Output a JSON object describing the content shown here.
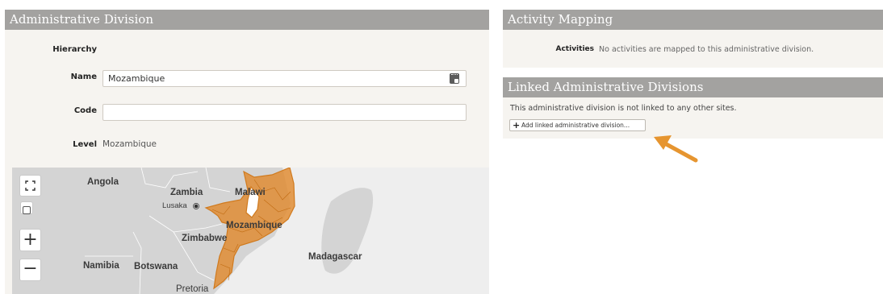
{
  "admin_division": {
    "header": "Administrative Division",
    "hierarchy_label": "Hierarchy",
    "name_label": "Name",
    "name_value": "Mozambique",
    "code_label": "Code",
    "code_value": "",
    "level_label": "Level",
    "level_value": "Mozambique"
  },
  "map": {
    "labels": {
      "angola": "Angola",
      "zambia": "Zambia",
      "malawi": "Malawi",
      "lusaka": "Lusaka",
      "mozambique": "Mozambique",
      "zimbabwe": "Zimbabwe",
      "namibia": "Namibia",
      "botswana": "Botswana",
      "madagascar": "Madagascar",
      "pretoria": "Pretoria"
    },
    "zoom_in": "+",
    "zoom_out": "−",
    "highlight_color": "#e08a2e"
  },
  "activity_mapping": {
    "header": "Activity Mapping",
    "activities_label": "Activities",
    "activities_text": "No activities are mapped to this administrative division."
  },
  "linked_divisions": {
    "header": "Linked Administrative Divisions",
    "message": "This administrative division is not linked to any other sites.",
    "add_button_label": "Add linked administrative division..."
  },
  "annotation": {
    "arrow_color": "#e69530"
  }
}
